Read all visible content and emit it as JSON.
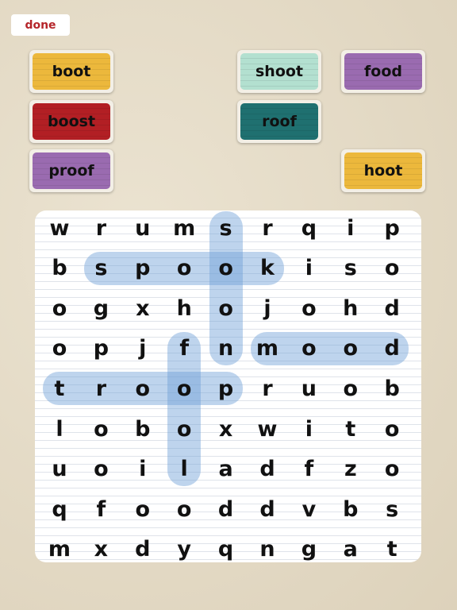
{
  "done_label": "done",
  "words": [
    {
      "label": "boot",
      "color": "#ecb83c"
    },
    {
      "label": "boost",
      "color": "#b21f24"
    },
    {
      "label": "proof",
      "color": "#9a6bb0"
    },
    {
      "label": "shoot",
      "color": "#b3e0d0"
    },
    {
      "label": "roof",
      "color": "#1f7070"
    },
    {
      "label": "food",
      "color": "#9a6bb0"
    },
    {
      "label": "hoot",
      "color": "#ecb83c"
    }
  ],
  "grid": [
    "wrumsrqip",
    "bspookiso",
    "ogxhojohd",
    "opjfnmood",
    "troopruob",
    "lomoxwito",
    "uoiladfzo",
    "qfooddvbs",
    "mxdyqngat"
  ],
  "found_words": [
    {
      "word": "spook",
      "from": [
        1,
        1
      ],
      "to": [
        1,
        5
      ]
    },
    {
      "word": "soon",
      "from": [
        0,
        4
      ],
      "to": [
        3,
        4
      ]
    },
    {
      "word": "mood",
      "from": [
        3,
        5
      ],
      "to": [
        3,
        8
      ]
    },
    {
      "word": "troop",
      "from": [
        4,
        0
      ],
      "to": [
        4,
        4
      ]
    },
    {
      "word": "fool",
      "from": [
        3,
        3
      ],
      "to": [
        6,
        3
      ]
    }
  ],
  "highlight_color": "#6ea0d7"
}
